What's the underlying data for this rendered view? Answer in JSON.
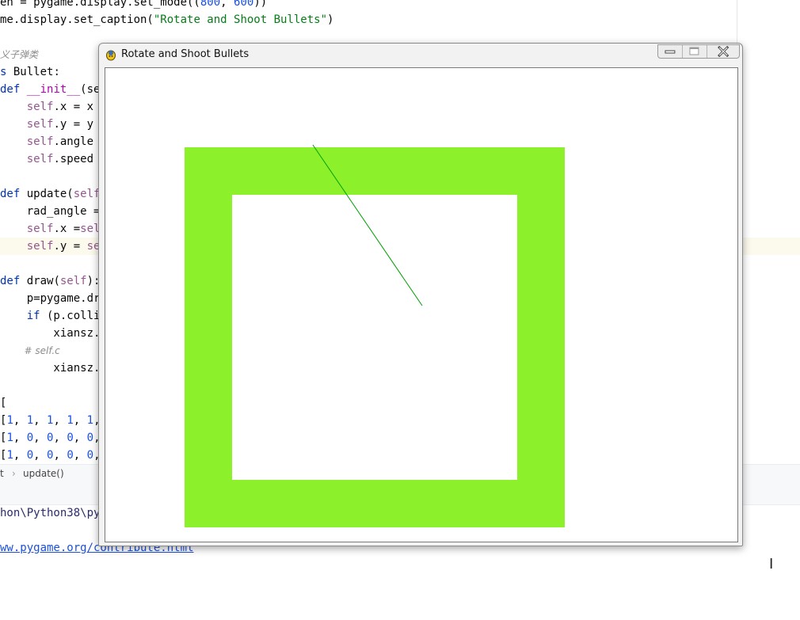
{
  "editor": {
    "lines": [
      {
        "parts": [
          {
            "t": "en = pygame.display.set_mode((",
            "c": ""
          },
          {
            "t": "800",
            "c": "num"
          },
          {
            "t": ", ",
            "c": ""
          },
          {
            "t": "600",
            "c": "num"
          },
          {
            "t": "))",
            "c": ""
          }
        ]
      },
      {
        "parts": [
          {
            "t": "me.display.set_caption(",
            "c": ""
          },
          {
            "t": "\"Rotate and Shoot Bullets\"",
            "c": "str"
          },
          {
            "t": ")",
            "c": ""
          }
        ]
      },
      {
        "parts": []
      },
      {
        "parts": [
          {
            "t": "义子弹类",
            "c": "cmt"
          }
        ]
      },
      {
        "parts": [
          {
            "t": "s",
            "c": "kw"
          },
          {
            "t": " Bullet:",
            "c": ""
          }
        ]
      },
      {
        "parts": [
          {
            "t": "def",
            "c": "kw"
          },
          {
            "t": " ",
            "c": ""
          },
          {
            "t": "__init__",
            "c": "fn"
          },
          {
            "t": "(sel",
            "c": ""
          }
        ]
      },
      {
        "parts": [
          {
            "t": "    ",
            "c": ""
          },
          {
            "t": "self",
            "c": "self"
          },
          {
            "t": ".x = x",
            "c": ""
          }
        ]
      },
      {
        "parts": [
          {
            "t": "    ",
            "c": ""
          },
          {
            "t": "self",
            "c": "self"
          },
          {
            "t": ".y = y",
            "c": ""
          }
        ]
      },
      {
        "parts": [
          {
            "t": "    ",
            "c": ""
          },
          {
            "t": "self",
            "c": "self"
          },
          {
            "t": ".angle = ",
            "c": ""
          }
        ]
      },
      {
        "parts": [
          {
            "t": "    ",
            "c": ""
          },
          {
            "t": "self",
            "c": "self"
          },
          {
            "t": ".speed = ",
            "c": ""
          }
        ]
      },
      {
        "parts": []
      },
      {
        "parts": [
          {
            "t": "def",
            "c": "kw"
          },
          {
            "t": " update(",
            "c": ""
          },
          {
            "t": "self",
            "c": "self"
          },
          {
            "t": ")",
            "c": ""
          }
        ]
      },
      {
        "parts": [
          {
            "t": "    rad_angle = ",
            "c": ""
          }
        ]
      },
      {
        "parts": [
          {
            "t": "    ",
            "c": ""
          },
          {
            "t": "self",
            "c": "self"
          },
          {
            "t": ".x =",
            "c": ""
          },
          {
            "t": "sel",
            "c": "self"
          }
        ]
      },
      {
        "parts": [
          {
            "t": "    ",
            "c": ""
          },
          {
            "t": "self",
            "c": "self"
          },
          {
            "t": ".y = ",
            "c": ""
          },
          {
            "t": "se",
            "c": "self"
          }
        ]
      },
      {
        "parts": []
      },
      {
        "parts": [
          {
            "t": "def",
            "c": "kw"
          },
          {
            "t": " draw(",
            "c": ""
          },
          {
            "t": "self",
            "c": "self"
          },
          {
            "t": "):",
            "c": ""
          }
        ]
      },
      {
        "parts": [
          {
            "t": "    p=pygame.dra",
            "c": ""
          }
        ]
      },
      {
        "parts": [
          {
            "t": "    ",
            "c": ""
          },
          {
            "t": "if",
            "c": "kw"
          },
          {
            "t": " (p.colli",
            "c": ""
          }
        ]
      },
      {
        "parts": [
          {
            "t": "        xiansz.c",
            "c": ""
          }
        ]
      },
      {
        "parts": [
          {
            "t": "        # self.c",
            "c": "cmt"
          }
        ]
      },
      {
        "parts": [
          {
            "t": "        xiansz.a",
            "c": ""
          }
        ]
      },
      {
        "parts": []
      },
      {
        "parts": [
          {
            "t": "[",
            "c": ""
          }
        ]
      },
      {
        "parts": [
          {
            "t": "[",
            "c": ""
          },
          {
            "t": "1",
            "c": "num"
          },
          {
            "t": ", ",
            "c": ""
          },
          {
            "t": "1",
            "c": "num"
          },
          {
            "t": ", ",
            "c": ""
          },
          {
            "t": "1",
            "c": "num"
          },
          {
            "t": ", ",
            "c": ""
          },
          {
            "t": "1",
            "c": "num"
          },
          {
            "t": ", ",
            "c": ""
          },
          {
            "t": "1",
            "c": "num"
          },
          {
            "t": ",",
            "c": ""
          }
        ]
      },
      {
        "parts": [
          {
            "t": "[",
            "c": ""
          },
          {
            "t": "1",
            "c": "num"
          },
          {
            "t": ", ",
            "c": ""
          },
          {
            "t": "0",
            "c": "num"
          },
          {
            "t": ", ",
            "c": ""
          },
          {
            "t": "0",
            "c": "num"
          },
          {
            "t": ", ",
            "c": ""
          },
          {
            "t": "0",
            "c": "num"
          },
          {
            "t": ", ",
            "c": ""
          },
          {
            "t": "0",
            "c": "num"
          },
          {
            "t": ",",
            "c": ""
          }
        ]
      },
      {
        "parts": [
          {
            "t": "[",
            "c": ""
          },
          {
            "t": "1",
            "c": "num"
          },
          {
            "t": ", ",
            "c": ""
          },
          {
            "t": "0",
            "c": "num"
          },
          {
            "t": ", ",
            "c": ""
          },
          {
            "t": "0",
            "c": "num"
          },
          {
            "t": ", ",
            "c": ""
          },
          {
            "t": "0",
            "c": "num"
          },
          {
            "t": ", ",
            "c": ""
          },
          {
            "t": "0",
            "c": "num"
          },
          {
            "t": ",",
            "c": ""
          }
        ]
      }
    ]
  },
  "breadcrumb": {
    "left": "t",
    "separator": "›",
    "item": "update()"
  },
  "console": {
    "path": "hon\\Python38\\pyt",
    "link": "ww.pygame.org/contribute.html"
  },
  "pygame_window": {
    "title": "Rotate and Shoot Bullets",
    "canvas": {
      "size": [
        800,
        600
      ],
      "background": "#ffffff",
      "wall_color": "#8cf02a",
      "line_color": "#00a000"
    }
  },
  "colors": {
    "code_keyword": "#0033b3",
    "code_string": "#067d17",
    "code_number": "#1750eb",
    "code_self": "#94558d"
  }
}
